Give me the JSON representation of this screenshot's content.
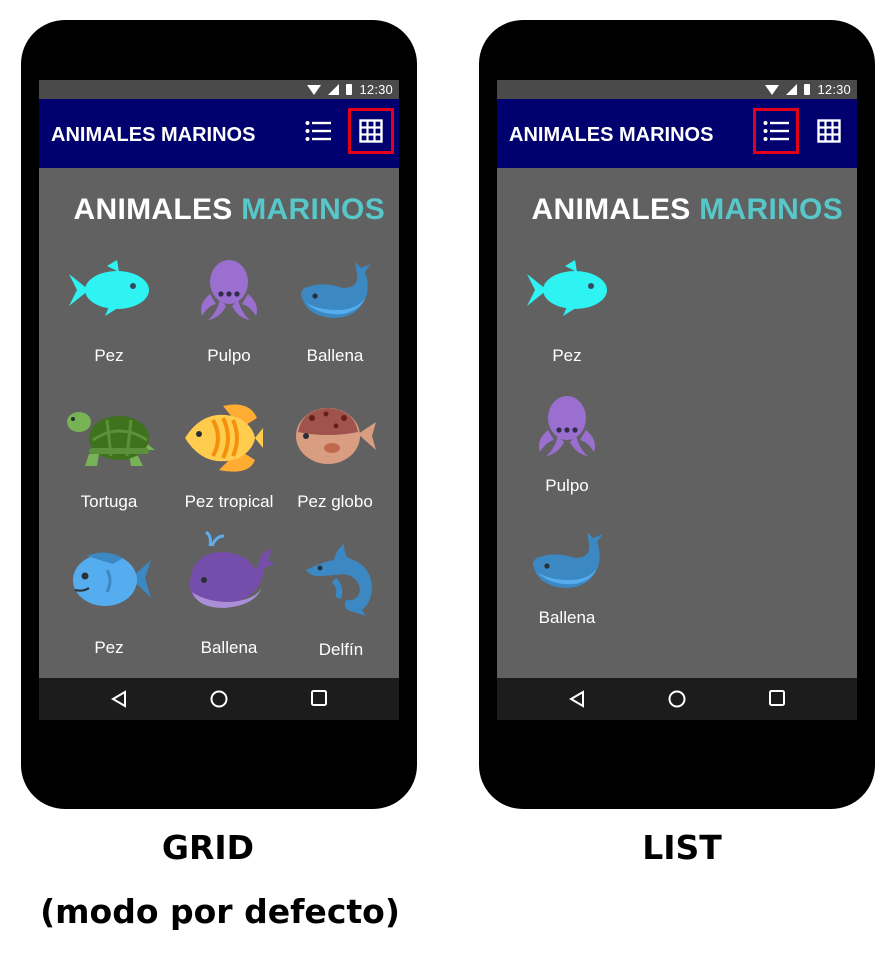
{
  "grid_mode": {
    "status_time": "12:30",
    "app_title": "ANIMALES MARINOS",
    "list_button": "list-icon",
    "grid_button": "grid-icon",
    "heading_part1": "ANIMALES",
    "heading_part2": "MARINOS",
    "selected_view": "grid",
    "items": [
      {
        "label": "Pez",
        "icon": "fish-icon"
      },
      {
        "label": "Pulpo",
        "icon": "octopus-icon"
      },
      {
        "label": "Ballena",
        "icon": "whale-icon"
      },
      {
        "label": "Tortuga",
        "icon": "turtle-icon"
      },
      {
        "label": "Pez tropical",
        "icon": "tropical-fish-icon"
      },
      {
        "label": "Pez globo",
        "icon": "pufferfish-icon"
      },
      {
        "label": "Pez",
        "icon": "fish-icon"
      },
      {
        "label": "Ballena",
        "icon": "whale-icon"
      },
      {
        "label": "Delfín",
        "icon": "dolphin-icon"
      }
    ],
    "caption_line1": "GRID",
    "caption_line2": "(modo por defecto)"
  },
  "list_mode": {
    "status_time": "12:30",
    "app_title": "ANIMALES MARINOS",
    "heading_part1": "ANIMALES",
    "heading_part2": "MARINOS",
    "selected_view": "list",
    "items": [
      {
        "label": "Pez",
        "icon": "fish-icon"
      },
      {
        "label": "Pulpo",
        "icon": "octopus-icon"
      },
      {
        "label": "Ballena",
        "icon": "whale-icon"
      }
    ],
    "caption": "LIST"
  },
  "colors": {
    "app_bar": "#00006e",
    "screen_bg": "#616161",
    "accent_heading": "#58c7c9",
    "selection_outline": "#e2001a"
  }
}
